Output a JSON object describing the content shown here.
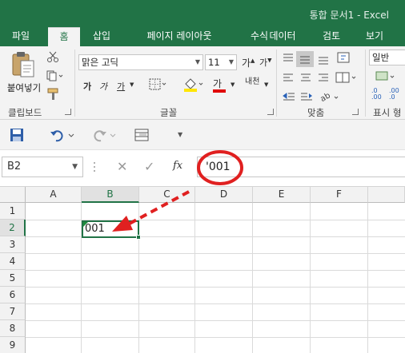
{
  "window": {
    "title": "통합 문서1 - Excel"
  },
  "tabs": [
    {
      "label": "파일"
    },
    {
      "label": "홈"
    },
    {
      "label": "삽입"
    },
    {
      "label": "페이지 레이아웃"
    },
    {
      "label": "수식"
    },
    {
      "label": "데이터"
    },
    {
      "label": "검토"
    },
    {
      "label": "보기"
    }
  ],
  "ribbon": {
    "clipboard": {
      "paste_label": "붙여넣기",
      "group_label": "클립보드"
    },
    "font": {
      "name": "맑은 고딕",
      "size": "11",
      "group_label": "글꼴",
      "bold": "가",
      "italic": "가",
      "underline": "가",
      "text_color_glyph": "가",
      "phonetic": "내천"
    },
    "alignment": {
      "group_label": "맞춤"
    },
    "number": {
      "format": "일반",
      "group_label": "표시 형"
    }
  },
  "namebox": {
    "value": "B2"
  },
  "formula": {
    "value": "'001"
  },
  "grid": {
    "columns": [
      "A",
      "B",
      "C",
      "D",
      "E",
      "F"
    ],
    "rows": [
      "1",
      "2",
      "3",
      "4",
      "5",
      "6",
      "7",
      "8",
      "9"
    ],
    "selected_cell": {
      "ref": "B2",
      "value": "001"
    }
  },
  "colors": {
    "excel_green": "#217346",
    "annotation_red": "#e02020"
  }
}
